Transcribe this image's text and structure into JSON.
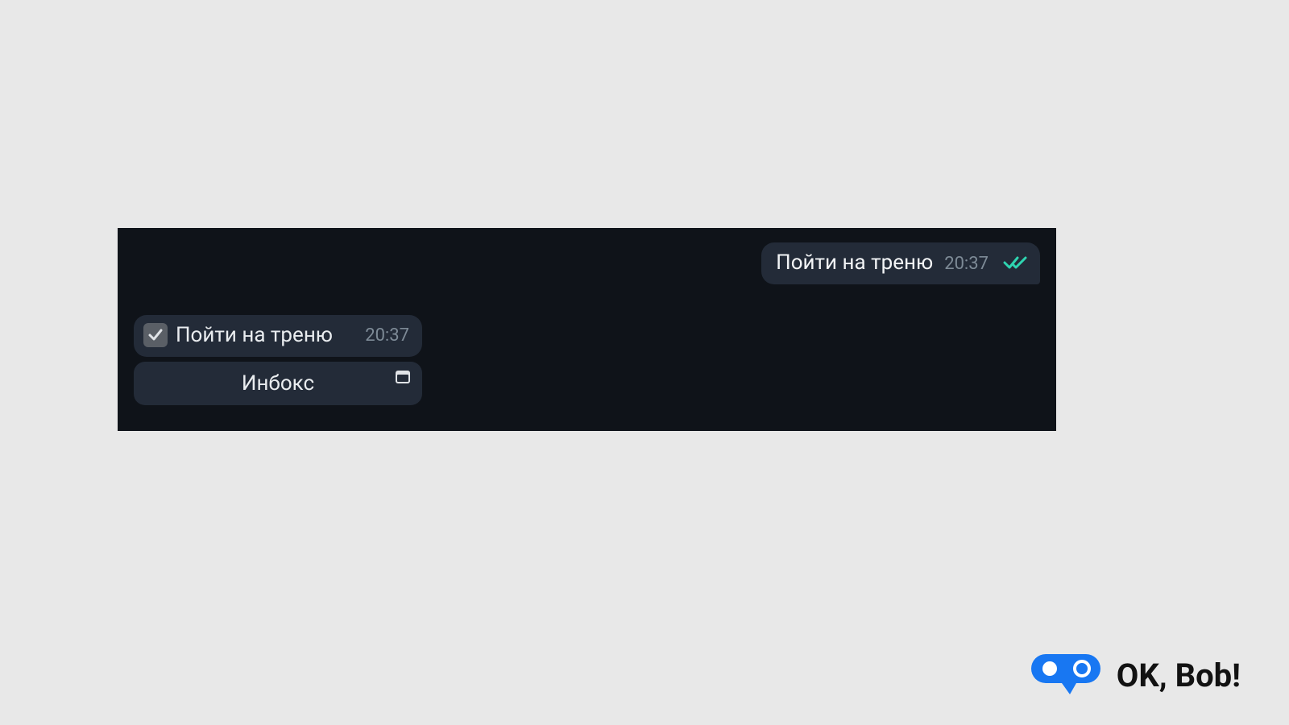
{
  "chat": {
    "outgoing": {
      "text": "Пойти на треню",
      "time": "20:37"
    },
    "task": {
      "text": "Пойти на треню",
      "time": "20:37"
    },
    "inbox_button": {
      "label": "Инбокс"
    }
  },
  "footer": {
    "brand": "OK, Bob!"
  },
  "colors": {
    "chat_bg": "#0f1319",
    "bubble_bg": "#232b38",
    "text": "#f2f4f6",
    "time": "#7d8a96",
    "tick": "#2fd4b0",
    "logo_blue": "#1877f2"
  }
}
